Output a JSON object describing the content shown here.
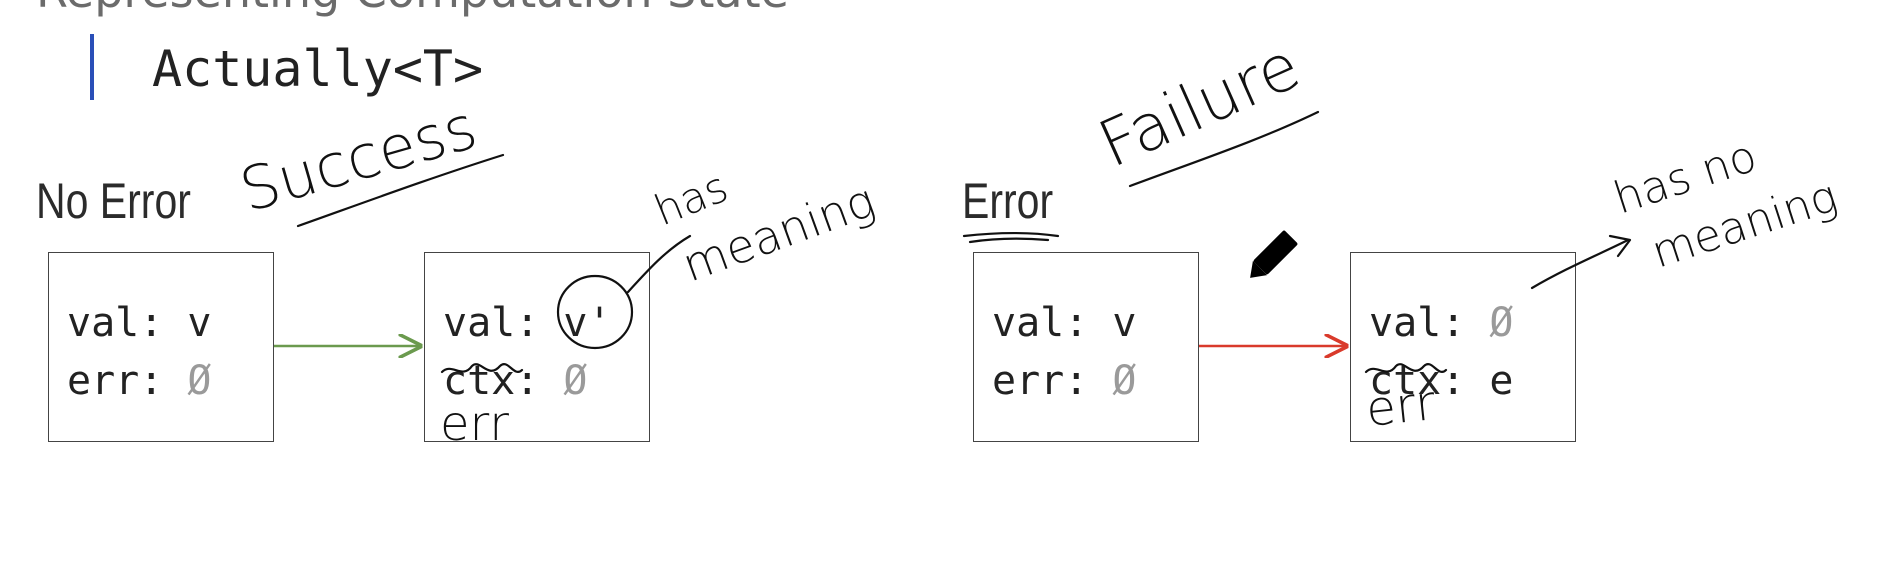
{
  "slide": {
    "top_text": "Representing Computation State",
    "type_name": "Actually<T>"
  },
  "sections": {
    "no_error": {
      "heading": "No Error",
      "annotation": "Success"
    },
    "error": {
      "heading": "Error",
      "annotation": "Failure"
    }
  },
  "boxes": [
    {
      "label_1": "val:",
      "value_1": "v",
      "label_2": "err:",
      "value_2": "Ø"
    },
    {
      "label_1": "val:",
      "value_1": "v'",
      "label_2": "ctx:",
      "value_2": "Ø",
      "correction": "err"
    },
    {
      "label_1": "val:",
      "value_1": "v",
      "label_2": "err:",
      "value_2": "Ø"
    },
    {
      "label_1": "val:",
      "value_1": "Ø",
      "label_2": "ctx:",
      "value_2": "e",
      "correction": "err"
    }
  ],
  "handwritten_notes": {
    "meaningful": [
      "has",
      "meaning"
    ],
    "not_meaningful": [
      "has no",
      "meaning"
    ]
  },
  "colors": {
    "success_arrow": "#6b9a4e",
    "failure_arrow": "#d93a2b",
    "null_symbol": "#9a9a9a",
    "quote_bar": "#2a4fb8"
  },
  "icons": {
    "cursor": "pencil-icon"
  }
}
